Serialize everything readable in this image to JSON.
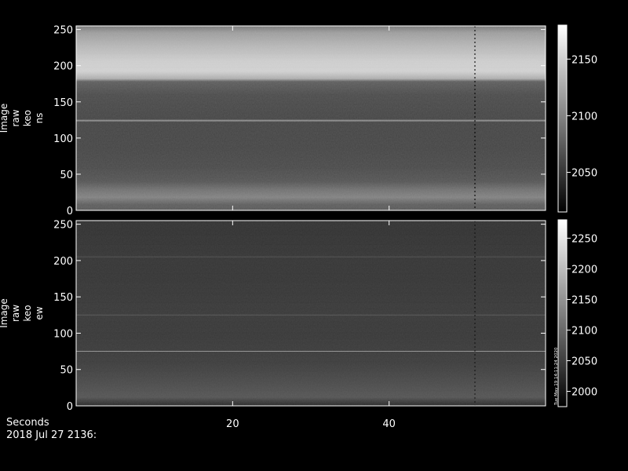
{
  "chart_data": [
    {
      "type": "heatmap",
      "ylabel_lines": [
        "Image",
        "raw",
        "keo",
        "ns"
      ],
      "ylim": [
        0,
        255
      ],
      "yticks": [
        0,
        50,
        100,
        150,
        200,
        250
      ],
      "xlim": [
        0,
        60
      ],
      "colorbar": {
        "ticks": [
          2050,
          2100,
          2150
        ],
        "range": [
          2015,
          2180
        ]
      },
      "row_profile": [
        {
          "y": 0,
          "v": 2075
        },
        {
          "y": 8,
          "v": 2078
        },
        {
          "y": 18,
          "v": 2100
        },
        {
          "y": 28,
          "v": 2090
        },
        {
          "y": 40,
          "v": 2072
        },
        {
          "y": 60,
          "v": 2065
        },
        {
          "y": 90,
          "v": 2062
        },
        {
          "y": 122,
          "v": 2062
        },
        {
          "y": 124,
          "v": 2110
        },
        {
          "y": 126,
          "v": 2062
        },
        {
          "y": 160,
          "v": 2066
        },
        {
          "y": 178,
          "v": 2078
        },
        {
          "y": 182,
          "v": 2128
        },
        {
          "y": 192,
          "v": 2150
        },
        {
          "y": 205,
          "v": 2148
        },
        {
          "y": 225,
          "v": 2135
        },
        {
          "y": 245,
          "v": 2118
        },
        {
          "y": 255,
          "v": 2095
        }
      ]
    },
    {
      "type": "heatmap",
      "ylabel_lines": [
        "Image",
        "raw",
        "keo",
        "ew"
      ],
      "ylim": [
        0,
        255
      ],
      "yticks": [
        0,
        50,
        100,
        150,
        200,
        250
      ],
      "xlim": [
        0,
        60
      ],
      "colorbar": {
        "ticks": [
          2000,
          2050,
          2100,
          2150,
          2200,
          2250
        ],
        "range": [
          1975,
          2280
        ]
      },
      "colorbar_annotation": "Tue May 19 14:11:24 2020",
      "row_profile": [
        {
          "y": 0,
          "v": 2030
        },
        {
          "y": 4,
          "v": 2045
        },
        {
          "y": 12,
          "v": 2080
        },
        {
          "y": 25,
          "v": 2072
        },
        {
          "y": 45,
          "v": 2060
        },
        {
          "y": 60,
          "v": 2052
        },
        {
          "y": 74,
          "v": 2050
        },
        {
          "y": 75,
          "v": 2160
        },
        {
          "y": 76,
          "v": 2050
        },
        {
          "y": 100,
          "v": 2046
        },
        {
          "y": 124,
          "v": 2048
        },
        {
          "y": 125,
          "v": 2085
        },
        {
          "y": 126,
          "v": 2048
        },
        {
          "y": 160,
          "v": 2044
        },
        {
          "y": 204,
          "v": 2043
        },
        {
          "y": 205,
          "v": 2075
        },
        {
          "y": 206,
          "v": 2043
        },
        {
          "y": 235,
          "v": 2040
        },
        {
          "y": 255,
          "v": 2040
        }
      ]
    }
  ],
  "xaxis": {
    "label": "Seconds",
    "ticks": [
      20,
      40
    ]
  },
  "date_label": "2018 Jul 27 2136:"
}
